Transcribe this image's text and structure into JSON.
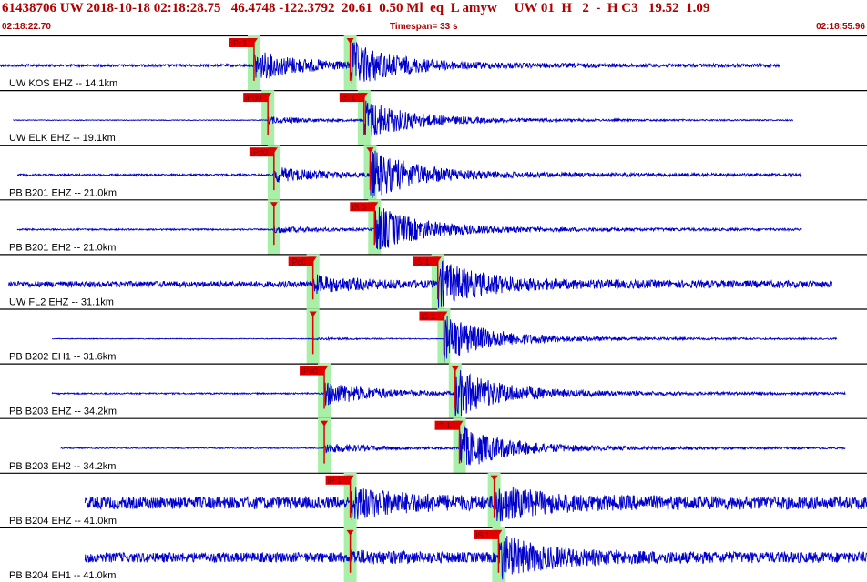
{
  "header": {
    "title": "61438706 UW 2018-10-18 02:18:28.75   46.4748 -122.3792  20.61  0.50 Ml  eq  L amyw     UW 01  H   2  -  H C3   19.52  1.09",
    "start_time": "02:18:22.70",
    "end_time": "02:18:55.96",
    "timespan_label": "Timespan=  33 s"
  },
  "colors": {
    "waveform": "#0000cc",
    "pick_flag": "#e00000",
    "pick_window": "#a8f0a8",
    "header_text": "#b00000",
    "separator": "#000000"
  },
  "traces": [
    {
      "label": "UW KOS EHZ -- 14.1km",
      "start": 0.0,
      "end": 0.9,
      "picks": [
        {
          "phase": "iP",
          "text": "iPc1",
          "t": 0.293
        },
        {
          "phase": "S",
          "text": "",
          "t": 0.404
        }
      ],
      "onset_amp": 0.6,
      "s_amp": 0.8,
      "noise": 0.05
    },
    {
      "label": "UW ELK EHZ -- 19.1km",
      "start": 0.015,
      "end": 0.915,
      "picks": [
        {
          "phase": "iP",
          "text": "iPd0",
          "t": 0.309
        },
        {
          "phase": "S",
          "text": "iS 1",
          "t": 0.42
        }
      ],
      "onset_amp": 0.15,
      "s_amp": 0.8,
      "noise": 0.01
    },
    {
      "label": "PB B201 EHZ -- 21.0km",
      "start": 0.02,
      "end": 0.925,
      "picks": [
        {
          "phase": "iP",
          "text": "iPd0",
          "t": 0.316
        },
        {
          "phase": "S",
          "text": "",
          "t": 0.427
        }
      ],
      "onset_amp": 0.3,
      "s_amp": 0.9,
      "noise": 0.04
    },
    {
      "label": "PB B201 EH2 -- 21.0km",
      "start": 0.02,
      "end": 0.925,
      "picks": [
        {
          "phase": "P",
          "text": "",
          "t": 0.316
        },
        {
          "phase": "S",
          "text": "iS 0",
          "t": 0.432
        }
      ],
      "onset_amp": 0.12,
      "s_amp": 0.9,
      "noise": 0.03
    },
    {
      "label": "UW FL2 EHZ -- 31.1km",
      "start": 0.01,
      "end": 0.96,
      "picks": [
        {
          "phase": "iP",
          "text": "iPc0",
          "t": 0.361
        },
        {
          "phase": "S",
          "text": "iS 1",
          "t": 0.505
        }
      ],
      "onset_amp": 0.3,
      "s_amp": 0.8,
      "noise": 0.12
    },
    {
      "label": "PB B202 EH1 -- 31.6km",
      "start": 0.06,
      "end": 0.965,
      "picks": [
        {
          "phase": "P",
          "text": "",
          "t": 0.361
        },
        {
          "phase": "S",
          "text": "iS 1",
          "t": 0.512
        }
      ],
      "onset_amp": 0.05,
      "s_amp": 0.9,
      "noise": 0.01
    },
    {
      "label": "PB B203 EHZ -- 34.2km",
      "start": 0.06,
      "end": 0.975,
      "picks": [
        {
          "phase": "iP",
          "text": "iPd0",
          "t": 0.374
        },
        {
          "phase": "S",
          "text": "",
          "t": 0.525
        }
      ],
      "onset_amp": 0.5,
      "s_amp": 0.9,
      "noise": 0.03
    },
    {
      "label": "PB B203 EH2 -- 34.2km",
      "start": 0.07,
      "end": 0.975,
      "picks": [
        {
          "phase": "P",
          "text": "",
          "t": 0.374
        },
        {
          "phase": "S",
          "text": "iS 1",
          "t": 0.53
        }
      ],
      "onset_amp": 0.2,
      "s_amp": 0.85,
      "noise": 0.02
    },
    {
      "label": "PB B204 EHZ -- 41.0km",
      "start": 0.098,
      "end": 1.0,
      "picks": [
        {
          "phase": "iP",
          "text": "iP 1",
          "t": 0.404
        },
        {
          "phase": "S",
          "text": "",
          "t": 0.57
        }
      ],
      "onset_amp": 0.55,
      "s_amp": 0.55,
      "noise": 0.25
    },
    {
      "label": "PB B204 EH1 -- 41.0km",
      "start": 0.098,
      "end": 1.0,
      "picks": [
        {
          "phase": "P",
          "text": "",
          "t": 0.404
        },
        {
          "phase": "S",
          "text": "iS 1",
          "t": 0.575
        }
      ],
      "onset_amp": 0.15,
      "s_amp": 0.75,
      "noise": 0.2
    }
  ]
}
